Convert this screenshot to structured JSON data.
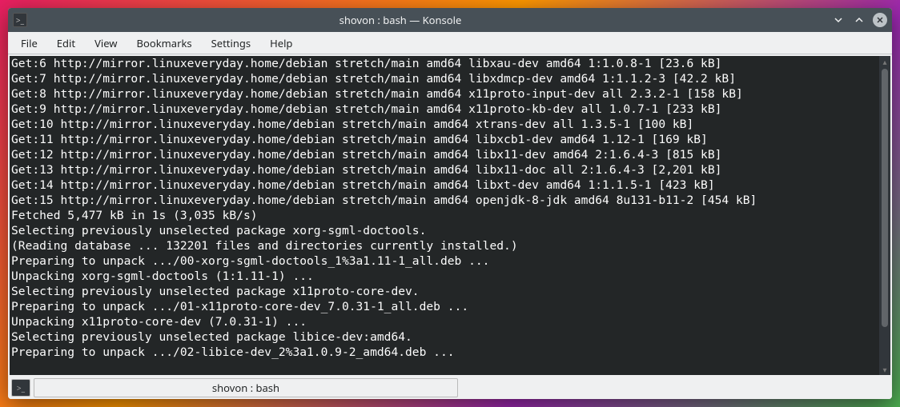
{
  "window": {
    "title": "shovon : bash — Konsole"
  },
  "menubar": {
    "items": [
      "File",
      "Edit",
      "View",
      "Bookmarks",
      "Settings",
      "Help"
    ]
  },
  "terminal": {
    "lines": [
      "Get:6 http://mirror.linuxeveryday.home/debian stretch/main amd64 libxau-dev amd64 1:1.0.8-1 [23.6 kB]",
      "Get:7 http://mirror.linuxeveryday.home/debian stretch/main amd64 libxdmcp-dev amd64 1:1.1.2-3 [42.2 kB]",
      "Get:8 http://mirror.linuxeveryday.home/debian stretch/main amd64 x11proto-input-dev all 2.3.2-1 [158 kB]",
      "Get:9 http://mirror.linuxeveryday.home/debian stretch/main amd64 x11proto-kb-dev all 1.0.7-1 [233 kB]",
      "Get:10 http://mirror.linuxeveryday.home/debian stretch/main amd64 xtrans-dev all 1.3.5-1 [100 kB]",
      "Get:11 http://mirror.linuxeveryday.home/debian stretch/main amd64 libxcb1-dev amd64 1.12-1 [169 kB]",
      "Get:12 http://mirror.linuxeveryday.home/debian stretch/main amd64 libx11-dev amd64 2:1.6.4-3 [815 kB]",
      "Get:13 http://mirror.linuxeveryday.home/debian stretch/main amd64 libx11-doc all 2:1.6.4-3 [2,201 kB]",
      "Get:14 http://mirror.linuxeveryday.home/debian stretch/main amd64 libxt-dev amd64 1:1.1.5-1 [423 kB]",
      "Get:15 http://mirror.linuxeveryday.home/debian stretch/main amd64 openjdk-8-jdk amd64 8u131-b11-2 [454 kB]",
      "Fetched 5,477 kB in 1s (3,035 kB/s)",
      "Selecting previously unselected package xorg-sgml-doctools.",
      "(Reading database ... 132201 files and directories currently installed.)",
      "Preparing to unpack .../00-xorg-sgml-doctools_1%3a1.11-1_all.deb ...",
      "Unpacking xorg-sgml-doctools (1:1.11-1) ...",
      "Selecting previously unselected package x11proto-core-dev.",
      "Preparing to unpack .../01-x11proto-core-dev_7.0.31-1_all.deb ...",
      "Unpacking x11proto-core-dev (7.0.31-1) ...",
      "Selecting previously unselected package libice-dev:amd64.",
      "Preparing to unpack .../02-libice-dev_2%3a1.0.9-2_amd64.deb ..."
    ]
  },
  "tabbar": {
    "tab_label": "shovon : bash"
  }
}
